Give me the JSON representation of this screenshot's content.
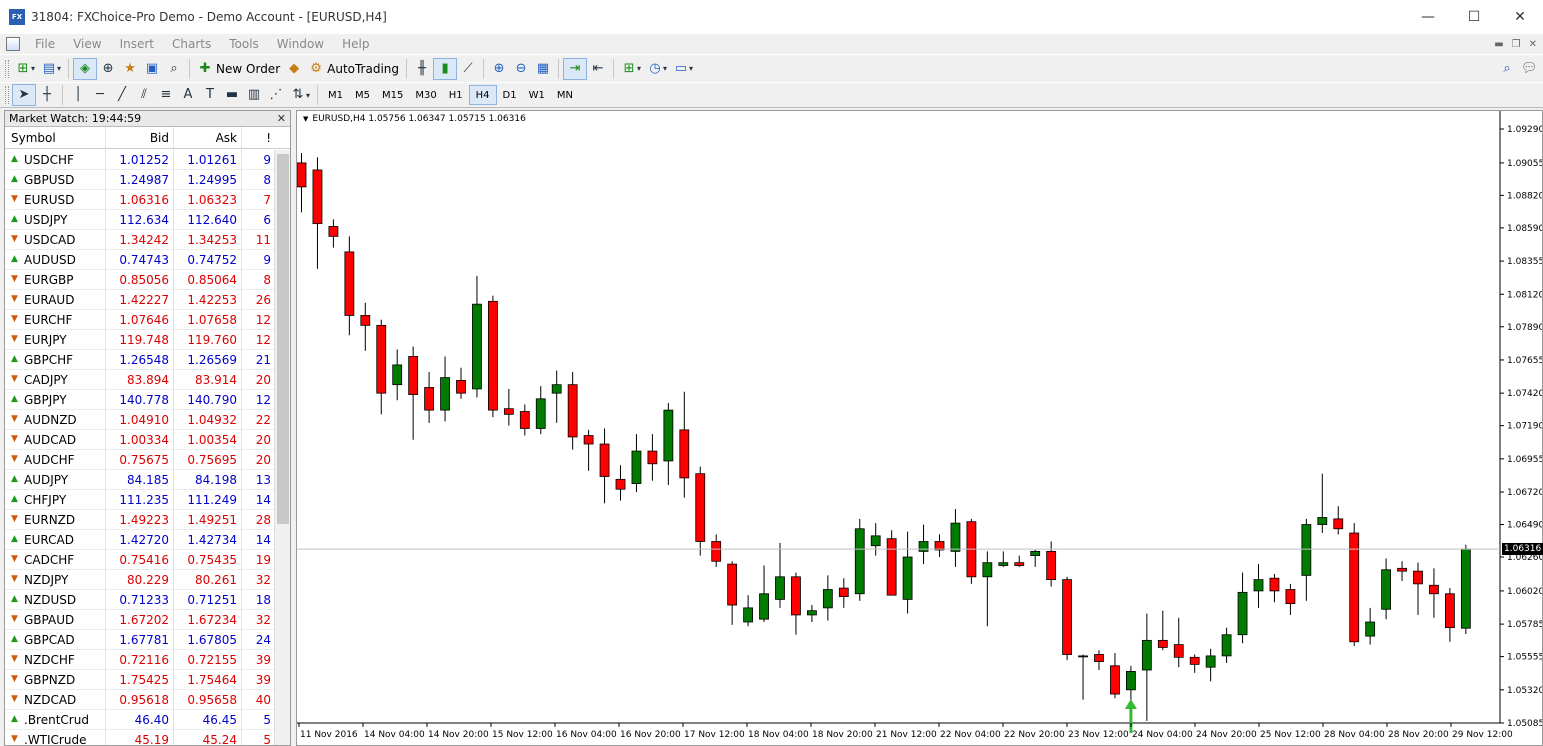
{
  "window": {
    "title": "31804: FXChoice-Pro Demo - Demo Account - [EURUSD,H4]",
    "icon_text": "FX",
    "minimize": "—",
    "maximize": "☐",
    "close": "✕"
  },
  "menu": [
    "File",
    "View",
    "Insert",
    "Charts",
    "Tools",
    "Window",
    "Help"
  ],
  "toolbar": {
    "new_order": "New Order",
    "autotrading": "AutoTrading"
  },
  "timeframes": [
    "M1",
    "M5",
    "M15",
    "M30",
    "H1",
    "H4",
    "D1",
    "W1",
    "MN"
  ],
  "active_timeframe": "H4",
  "market_watch": {
    "title": "Market Watch: 19:44:59",
    "columns": {
      "symbol": "Symbol",
      "bid": "Bid",
      "ask": "Ask",
      "spread": "!"
    },
    "rows": [
      {
        "symbol": "USDCHF",
        "bid": "1.01252",
        "ask": "1.01261",
        "spread": "9",
        "dir": "up"
      },
      {
        "symbol": "GBPUSD",
        "bid": "1.24987",
        "ask": "1.24995",
        "spread": "8",
        "dir": "up"
      },
      {
        "symbol": "EURUSD",
        "bid": "1.06316",
        "ask": "1.06323",
        "spread": "7",
        "dir": "down"
      },
      {
        "symbol": "USDJPY",
        "bid": "112.634",
        "ask": "112.640",
        "spread": "6",
        "dir": "up"
      },
      {
        "symbol": "USDCAD",
        "bid": "1.34242",
        "ask": "1.34253",
        "spread": "11",
        "dir": "down"
      },
      {
        "symbol": "AUDUSD",
        "bid": "0.74743",
        "ask": "0.74752",
        "spread": "9",
        "dir": "up"
      },
      {
        "symbol": "EURGBP",
        "bid": "0.85056",
        "ask": "0.85064",
        "spread": "8",
        "dir": "down"
      },
      {
        "symbol": "EURAUD",
        "bid": "1.42227",
        "ask": "1.42253",
        "spread": "26",
        "dir": "down"
      },
      {
        "symbol": "EURCHF",
        "bid": "1.07646",
        "ask": "1.07658",
        "spread": "12",
        "dir": "down"
      },
      {
        "symbol": "EURJPY",
        "bid": "119.748",
        "ask": "119.760",
        "spread": "12",
        "dir": "down"
      },
      {
        "symbol": "GBPCHF",
        "bid": "1.26548",
        "ask": "1.26569",
        "spread": "21",
        "dir": "up"
      },
      {
        "symbol": "CADJPY",
        "bid": "83.894",
        "ask": "83.914",
        "spread": "20",
        "dir": "down"
      },
      {
        "symbol": "GBPJPY",
        "bid": "140.778",
        "ask": "140.790",
        "spread": "12",
        "dir": "up"
      },
      {
        "symbol": "AUDNZD",
        "bid": "1.04910",
        "ask": "1.04932",
        "spread": "22",
        "dir": "down"
      },
      {
        "symbol": "AUDCAD",
        "bid": "1.00334",
        "ask": "1.00354",
        "spread": "20",
        "dir": "down"
      },
      {
        "symbol": "AUDCHF",
        "bid": "0.75675",
        "ask": "0.75695",
        "spread": "20",
        "dir": "down"
      },
      {
        "symbol": "AUDJPY",
        "bid": "84.185",
        "ask": "84.198",
        "spread": "13",
        "dir": "up"
      },
      {
        "symbol": "CHFJPY",
        "bid": "111.235",
        "ask": "111.249",
        "spread": "14",
        "dir": "up"
      },
      {
        "symbol": "EURNZD",
        "bid": "1.49223",
        "ask": "1.49251",
        "spread": "28",
        "dir": "down"
      },
      {
        "symbol": "EURCAD",
        "bid": "1.42720",
        "ask": "1.42734",
        "spread": "14",
        "dir": "up"
      },
      {
        "symbol": "CADCHF",
        "bid": "0.75416",
        "ask": "0.75435",
        "spread": "19",
        "dir": "down"
      },
      {
        "symbol": "NZDJPY",
        "bid": "80.229",
        "ask": "80.261",
        "spread": "32",
        "dir": "down"
      },
      {
        "symbol": "NZDUSD",
        "bid": "0.71233",
        "ask": "0.71251",
        "spread": "18",
        "dir": "up"
      },
      {
        "symbol": "GBPAUD",
        "bid": "1.67202",
        "ask": "1.67234",
        "spread": "32",
        "dir": "down"
      },
      {
        "symbol": "GBPCAD",
        "bid": "1.67781",
        "ask": "1.67805",
        "spread": "24",
        "dir": "up"
      },
      {
        "symbol": "NZDCHF",
        "bid": "0.72116",
        "ask": "0.72155",
        "spread": "39",
        "dir": "down"
      },
      {
        "symbol": "GBPNZD",
        "bid": "1.75425",
        "ask": "1.75464",
        "spread": "39",
        "dir": "down"
      },
      {
        "symbol": "NZDCAD",
        "bid": "0.95618",
        "ask": "0.95658",
        "spread": "40",
        "dir": "down"
      },
      {
        "symbol": ".BrentCrud",
        "bid": "46.40",
        "ask": "46.45",
        "spread": "5",
        "dir": "up"
      },
      {
        "symbol": ".WTICrude",
        "bid": "45.19",
        "ask": "45.24",
        "spread": "5",
        "dir": "down"
      }
    ]
  },
  "chart": {
    "header": "EURUSD,H4  1.05756 1.06347 1.05715 1.06316",
    "current_price_label": "1.06316"
  },
  "chart_data": {
    "type": "candlestick",
    "symbol": "EURUSD",
    "timeframe": "H4",
    "ohlc_last": {
      "open": 1.05756,
      "high": 1.06347,
      "low": 1.05715,
      "close": 1.06316
    },
    "current_price": 1.06316,
    "ylim": [
      1.05085,
      1.0929
    ],
    "y_ticks": [
      1.0929,
      1.0905,
      1.0882,
      1.0859,
      1.08355,
      1.0812,
      1.0789,
      1.07655,
      1.0742,
      1.0719,
      1.06955,
      1.0672,
      1.0649,
      1.0626,
      1.0602,
      1.05785,
      1.05555,
      1.0532,
      1.05085
    ],
    "y_tick_labels": [
      "1.09290",
      "1.09055",
      "1.08820",
      "1.08590",
      "1.08355",
      "1.08120",
      "1.07890",
      "1.07655",
      "1.07420",
      "1.07190",
      "1.06955",
      "1.06720",
      "1.06490",
      "1.06260",
      "1.06020",
      "1.05785",
      "1.05555",
      "1.05320",
      "1.05085"
    ],
    "x_tick_labels": [
      "11 Nov 2016",
      "14 Nov 04:00",
      "14 Nov 20:00",
      "15 Nov 12:00",
      "16 Nov 04:00",
      "16 Nov 20:00",
      "17 Nov 12:00",
      "18 Nov 04:00",
      "18 Nov 20:00",
      "21 Nov 12:00",
      "22 Nov 04:00",
      "22 Nov 20:00",
      "23 Nov 12:00",
      "24 Nov 04:00",
      "24 Nov 20:00",
      "25 Nov 12:00",
      "28 Nov 04:00",
      "28 Nov 20:00",
      "29 Nov 12:00"
    ],
    "candles": [
      [
        1.0905,
        1.0912,
        1.087,
        1.0888
      ],
      [
        1.09,
        1.0909,
        1.083,
        1.0862
      ],
      [
        1.086,
        1.0865,
        1.0845,
        1.0853
      ],
      [
        1.0842,
        1.0853,
        1.0783,
        1.0797
      ],
      [
        1.0797,
        1.0806,
        1.0772,
        1.079
      ],
      [
        1.079,
        1.0794,
        1.0727,
        1.0742
      ],
      [
        1.0748,
        1.0773,
        1.0737,
        1.0762
      ],
      [
        1.0768,
        1.0775,
        1.0709,
        1.0741
      ],
      [
        1.0746,
        1.0757,
        1.0721,
        1.073
      ],
      [
        1.073,
        1.0768,
        1.0722,
        1.0753
      ],
      [
        1.0751,
        1.076,
        1.0738,
        1.0742
      ],
      [
        1.0745,
        1.0825,
        1.0739,
        1.0805
      ],
      [
        1.0807,
        1.0811,
        1.0725,
        1.073
      ],
      [
        1.0731,
        1.0745,
        1.0719,
        1.0727
      ],
      [
        1.0729,
        1.0734,
        1.0712,
        1.0717
      ],
      [
        1.0717,
        1.0747,
        1.0713,
        1.0738
      ],
      [
        1.0742,
        1.0758,
        1.0721,
        1.0748
      ],
      [
        1.0748,
        1.0757,
        1.0702,
        1.0711
      ],
      [
        1.0712,
        1.0716,
        1.0687,
        1.0706
      ],
      [
        1.0706,
        1.0717,
        1.0664,
        1.0683
      ],
      [
        1.0681,
        1.0691,
        1.0666,
        1.0674
      ],
      [
        1.0678,
        1.0713,
        1.0672,
        1.0701
      ],
      [
        1.0701,
        1.0713,
        1.068,
        1.0692
      ],
      [
        1.0694,
        1.0735,
        1.0677,
        1.073
      ],
      [
        1.0716,
        1.0743,
        1.0668,
        1.0682
      ],
      [
        1.0685,
        1.069,
        1.0627,
        1.0637
      ],
      [
        1.0637,
        1.0642,
        1.0619,
        1.0623
      ],
      [
        1.0621,
        1.0623,
        1.0578,
        1.0592
      ],
      [
        1.058,
        1.0599,
        1.0577,
        1.059
      ],
      [
        1.0582,
        1.062,
        1.058,
        1.06
      ],
      [
        1.0596,
        1.0636,
        1.059,
        1.0612
      ],
      [
        1.0612,
        1.0615,
        1.0571,
        1.0585
      ],
      [
        1.0585,
        1.0592,
        1.058,
        1.0588
      ],
      [
        1.059,
        1.0613,
        1.0581,
        1.0603
      ],
      [
        1.0604,
        1.0611,
        1.059,
        1.0598
      ],
      [
        1.06,
        1.0653,
        1.0595,
        1.0646
      ],
      [
        1.0634,
        1.065,
        1.0627,
        1.0641
      ],
      [
        1.0639,
        1.0645,
        1.0599,
        1.0599
      ],
      [
        1.0596,
        1.0644,
        1.0586,
        1.0626
      ],
      [
        1.063,
        1.0649,
        1.0621,
        1.0637
      ],
      [
        1.0637,
        1.0642,
        1.0626,
        1.0631
      ],
      [
        1.063,
        1.066,
        1.0619,
        1.065
      ],
      [
        1.0651,
        1.0653,
        1.0607,
        1.0612
      ],
      [
        1.0612,
        1.063,
        1.0577,
        1.0622
      ],
      [
        1.062,
        1.063,
        1.0619,
        1.0622
      ],
      [
        1.0622,
        1.0627,
        1.0619,
        1.062
      ],
      [
        1.0627,
        1.0631,
        1.0619,
        1.063
      ],
      [
        1.063,
        1.0637,
        1.0605,
        1.061
      ],
      [
        1.061,
        1.0612,
        1.0553,
        1.0557
      ],
      [
        1.0556,
        1.0557,
        1.0525,
        1.0556
      ],
      [
        1.0557,
        1.056,
        1.0546,
        1.0552
      ],
      [
        1.0549,
        1.0558,
        1.0526,
        1.0529
      ],
      [
        1.0532,
        1.0549,
        1.0514,
        1.0545
      ],
      [
        1.0546,
        1.0586,
        1.051,
        1.0567
      ],
      [
        1.0567,
        1.0588,
        1.056,
        1.0562
      ],
      [
        1.0564,
        1.0583,
        1.0548,
        1.0555
      ],
      [
        1.0555,
        1.0557,
        1.0544,
        1.055
      ],
      [
        1.0548,
        1.0561,
        1.0538,
        1.0556
      ],
      [
        1.0556,
        1.0576,
        1.0551,
        1.0571
      ],
      [
        1.0571,
        1.0615,
        1.0565,
        1.0601
      ],
      [
        1.0602,
        1.0621,
        1.059,
        1.061
      ],
      [
        1.0611,
        1.0614,
        1.0594,
        1.0602
      ],
      [
        1.0603,
        1.0607,
        1.0585,
        1.0593
      ],
      [
        1.0613,
        1.0653,
        1.0595,
        1.0649
      ],
      [
        1.0649,
        1.0685,
        1.0643,
        1.0654
      ],
      [
        1.0653,
        1.0662,
        1.0642,
        1.0646
      ],
      [
        1.0643,
        1.065,
        1.0563,
        1.0566
      ],
      [
        1.057,
        1.059,
        1.0564,
        1.058
      ],
      [
        1.0589,
        1.0625,
        1.0582,
        1.0617
      ],
      [
        1.0618,
        1.0623,
        1.0609,
        1.0616
      ],
      [
        1.0616,
        1.0622,
        1.0585,
        1.0607
      ],
      [
        1.0606,
        1.0618,
        1.0583,
        1.06
      ],
      [
        1.06,
        1.0604,
        1.0566,
        1.0576
      ],
      [
        1.05756,
        1.06347,
        1.05715,
        1.06316
      ]
    ]
  },
  "colors": {
    "bull": "#007a00",
    "bear": "#ff0000",
    "arrow": "#33bb33"
  }
}
